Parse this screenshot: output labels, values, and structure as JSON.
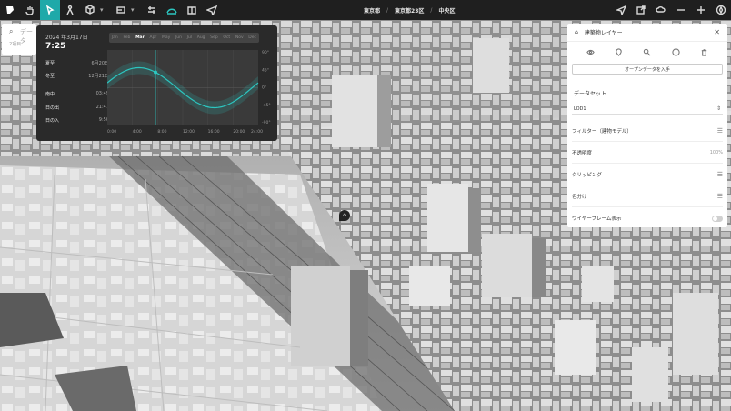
{
  "toolbar": {
    "tools": [
      "logo-icon",
      "hand-icon",
      "select-icon",
      "pedestrian-icon",
      "cube-icon",
      "sketch-icon",
      "sliders-icon",
      "sun-shadow-icon",
      "book-icon",
      "send-icon"
    ],
    "right_tools": [
      "location-icon",
      "export-icon",
      "cloud-icon",
      "zoom-out-icon",
      "zoom-in-icon",
      "compass-icon"
    ]
  },
  "breadcrumb": [
    "東京都",
    "東京都23区",
    "中央区"
  ],
  "search": {
    "placeholder": "データ",
    "sub": "2項目"
  },
  "sun": {
    "date": "2024 年3月17日",
    "time": "7:25",
    "rows": [
      {
        "k": "夏至",
        "v": "6月20日"
      },
      {
        "k": "冬至",
        "v": "12月21日"
      },
      {
        "k": "南中",
        "v": "03:49"
      },
      {
        "k": "日の出",
        "v": "21:47"
      },
      {
        "k": "日の入",
        "v": "9:50"
      }
    ],
    "months": [
      "Jan",
      "Feb",
      "Mar",
      "Apr",
      "May",
      "Jun",
      "Jul",
      "Aug",
      "Sep",
      "Oct",
      "Nov",
      "Dec"
    ],
    "active_month": "Mar",
    "x_ticks": [
      "0:00",
      "4:00",
      "8:00",
      "12:00",
      "16:00",
      "20:00",
      "24:00"
    ],
    "y_ticks": [
      "90°",
      "45°",
      "0°",
      "-45°",
      "-90°"
    ]
  },
  "layer_panel": {
    "title": "建築物レイヤー",
    "icons": [
      "eye-icon",
      "pin-icon",
      "search-icon",
      "info-icon",
      "trash-icon"
    ],
    "opendata_label": "オープンデータを入手",
    "dataset_label": "データセット",
    "dataset_value": "LOD1",
    "rows": [
      {
        "label": "フィルター（建物モデル）",
        "type": "tune"
      },
      {
        "label": "不透明度",
        "type": "value",
        "value": "100%"
      },
      {
        "label": "クリッピング",
        "type": "tune"
      },
      {
        "label": "色分け",
        "type": "tune"
      },
      {
        "label": "ワイヤーフレーム表示",
        "type": "toggle"
      }
    ]
  },
  "colors": {
    "accent": "#1fa9a9",
    "panel_dark": "#2a2a2a",
    "curve": "#2cc6c0"
  }
}
